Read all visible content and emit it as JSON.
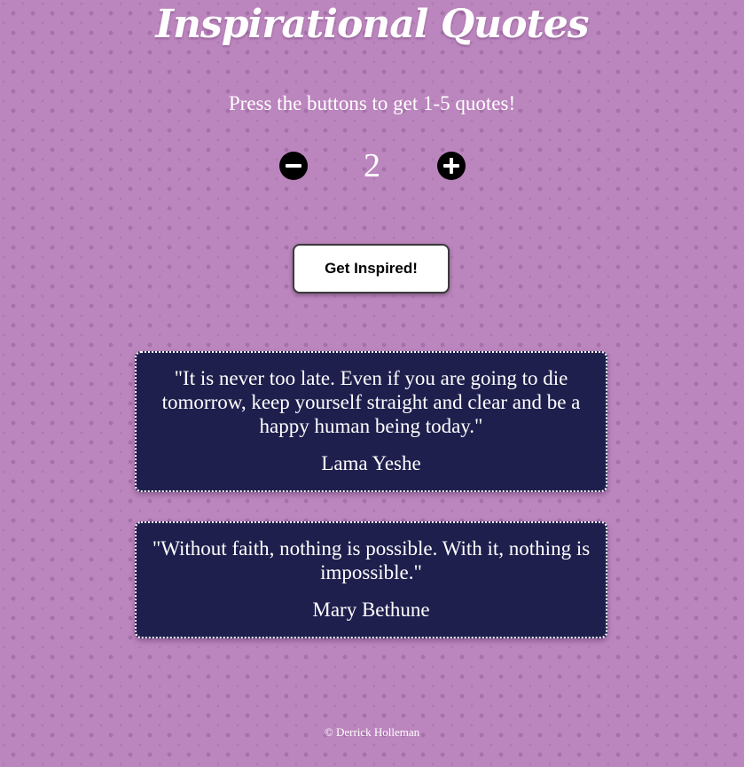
{
  "page": {
    "title": "Inspirational Quotes",
    "subtitle": "Press the buttons to get 1-5 quotes!",
    "counter": {
      "value": "2",
      "decrement_icon": "minus-circle-icon",
      "increment_icon": "plus-circle-icon"
    },
    "inspire_button_label": "Get Inspired!",
    "quotes": [
      {
        "text": "\"It is never too late. Even if you are going to die tomorrow, keep yourself straight and clear and be a happy human being today.\"",
        "author": "Lama Yeshe"
      },
      {
        "text": "\"Without faith, nothing is possible. With it, nothing is impossible.\"",
        "author": "Mary Bethune"
      }
    ],
    "footer": "© Derrick Holleman"
  },
  "colors": {
    "background": "#bb85bd",
    "card_background": "#1f1f4e",
    "text": "#ffffff",
    "button_background": "#ffffff",
    "icon_button": "#000000"
  }
}
